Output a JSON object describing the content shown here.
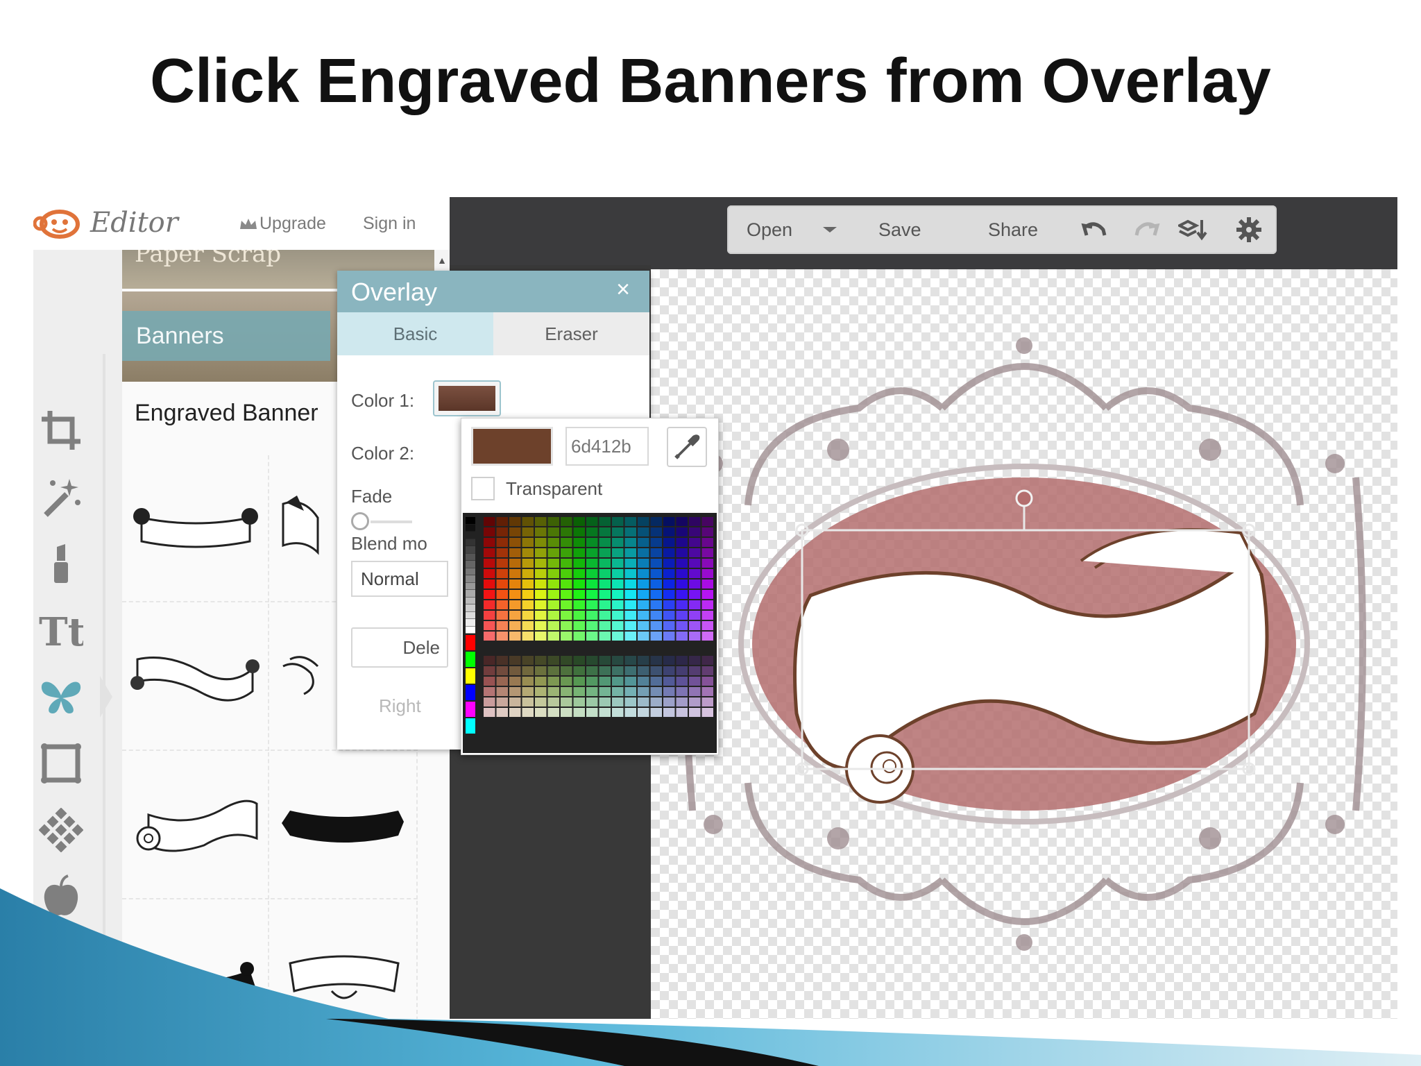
{
  "slide": {
    "title": "Click Engraved Banners from Overlay"
  },
  "app": {
    "logo_text": "Editor",
    "upgrade_label": "Upgrade",
    "signin_label": "Sign in"
  },
  "categories": {
    "paper_scrap_label": "Paper Scrap",
    "banners_label": "Banners",
    "engraved_title": "Engraved Banner"
  },
  "toolbar": {
    "open_label": "Open",
    "save_label": "Save",
    "share_label": "Share"
  },
  "overlay": {
    "title": "Overlay",
    "close_glyph": "×",
    "tab_basic": "Basic",
    "tab_eraser": "Eraser",
    "color1_label": "Color 1:",
    "color2_label": "Color 2:",
    "fade_label": "Fade",
    "blend_label": "Blend mo",
    "blend_value": "Normal",
    "delete_label": "Dele",
    "right_label": "Right"
  },
  "color_picker": {
    "hex_value": "6d412b",
    "transparent_label": "Transparent",
    "selected_color": "#6d412b"
  },
  "colors": {
    "accent_teal": "#8ab5bf",
    "banner_fill": "#b46e6e",
    "frame_gray": "#9d8b8e"
  },
  "tools": [
    "crop-icon",
    "magic-wand-icon",
    "lipstick-icon",
    "text-icon",
    "butterfly-icon",
    "frame-icon",
    "texture-icon",
    "apple-icon"
  ]
}
